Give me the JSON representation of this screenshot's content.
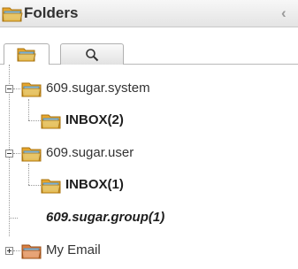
{
  "panel": {
    "title": "Folders",
    "collapse_glyph": "‹",
    "header_icon": "folder-icon",
    "collapse_icon": "chevron-left-icon"
  },
  "tabs": [
    {
      "name": "folders-tab",
      "icon": "folder-icon",
      "active": true
    },
    {
      "name": "search-tab",
      "icon": "search-icon",
      "active": false
    }
  ],
  "tree": {
    "nodes": [
      {
        "label": "609.sugar.system",
        "level": 0,
        "expanded": true,
        "style": "normal",
        "icon": "folder-icon"
      },
      {
        "label": "INBOX(2)",
        "level": 1,
        "style": "bold",
        "icon": "inbox-folder-icon"
      },
      {
        "label": "609.sugar.user",
        "level": 0,
        "expanded": true,
        "style": "normal",
        "icon": "folder-icon"
      },
      {
        "label": "INBOX(1)",
        "level": 1,
        "style": "bold",
        "icon": "inbox-folder-icon"
      },
      {
        "label": "609.sugar.group(1)",
        "level": 0,
        "style": "bold-italic",
        "icon": null
      },
      {
        "label": "My Email",
        "level": 0,
        "expanded": false,
        "style": "normal",
        "icon": "email-folder-icon"
      }
    ]
  },
  "colors": {
    "folder_body": "#f5c451",
    "folder_tab": "#e6a52c",
    "folder_screen": "#79b8e6",
    "email_body": "#f0a06a"
  }
}
